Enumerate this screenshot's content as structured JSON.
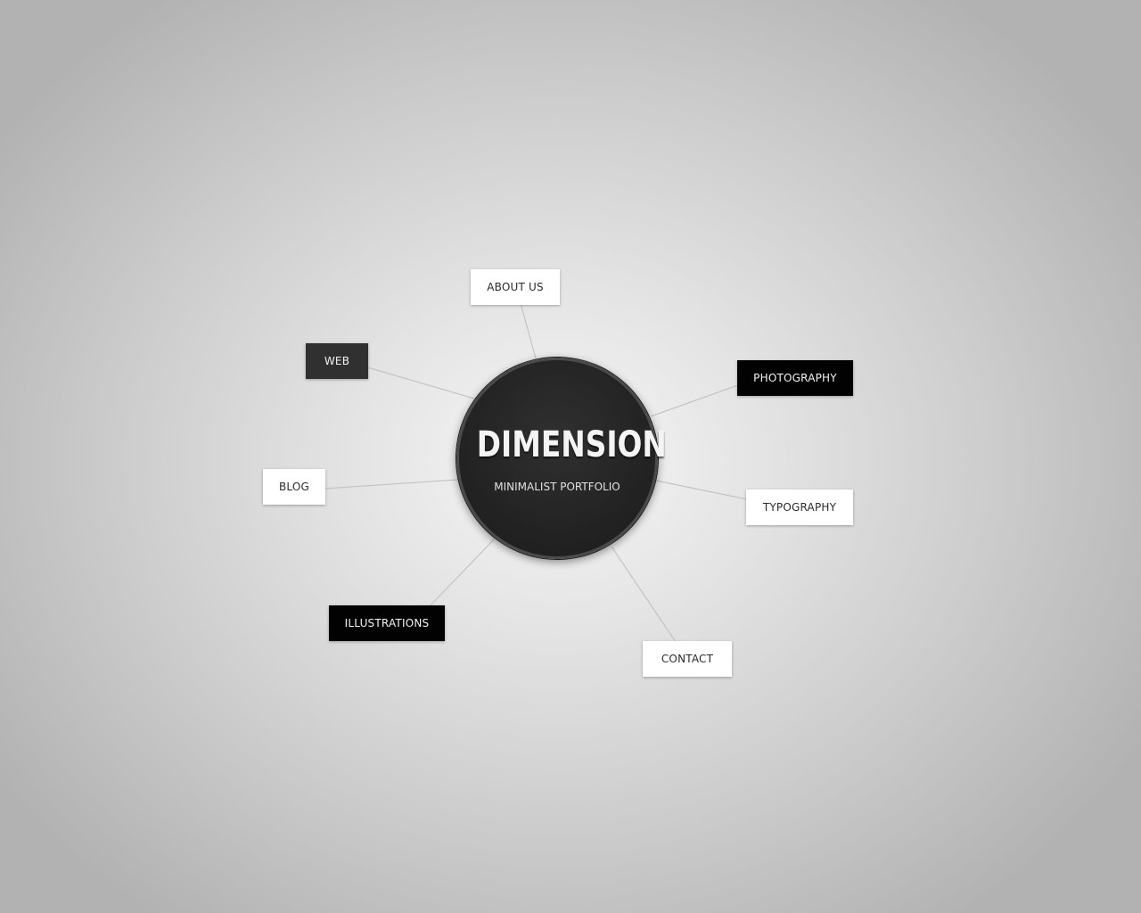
{
  "hub": {
    "title": "DIMENSION",
    "subtitle": "MINIMALIST PORTFOLIO"
  },
  "nav": {
    "about": "ABOUT US",
    "web": "WEB",
    "photography": "PHOTOGRAPHY",
    "blog": "BLOG",
    "typography": "TYPOGRAPHY",
    "illustrations": "ILLUSTRATIONS",
    "contact": "CONTACT"
  },
  "colors": {
    "background": "#d2d2d2",
    "hub_fill": "#242424",
    "node_light": "#ffffff",
    "node_dark": "#303030",
    "node_black": "#020202",
    "connector": "#c4c4c4"
  }
}
